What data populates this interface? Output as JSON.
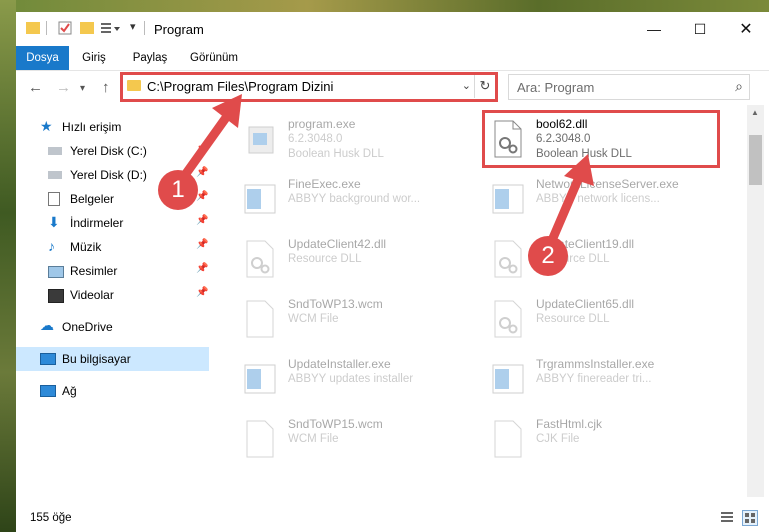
{
  "window": {
    "title": "Program"
  },
  "ribbon": {
    "tabs": [
      "Dosya",
      "Giriş",
      "Paylaş",
      "Görünüm"
    ]
  },
  "address": {
    "path": "C:\\Program Files\\Program Dizini"
  },
  "search": {
    "placeholder": "Ara: Program"
  },
  "nav": {
    "items": [
      {
        "label": "Hızlı erişim",
        "icon": "star-icon",
        "pinned": false
      },
      {
        "label": "Yerel Disk (C:)",
        "icon": "drive-icon",
        "pinned": true
      },
      {
        "label": "Yerel Disk (D:)",
        "icon": "drive-icon",
        "pinned": true
      },
      {
        "label": "Belgeler",
        "icon": "documents-icon",
        "pinned": true
      },
      {
        "label": "İndirmeler",
        "icon": "download-icon",
        "pinned": true
      },
      {
        "label": "Müzik",
        "icon": "music-icon",
        "pinned": true
      },
      {
        "label": "Resimler",
        "icon": "pictures-icon",
        "pinned": true
      },
      {
        "label": "Videolar",
        "icon": "videos-icon",
        "pinned": true
      },
      {
        "label": "OneDrive",
        "icon": "cloud-icon",
        "pinned": false
      },
      {
        "label": "Bu bilgisayar",
        "icon": "computer-icon",
        "pinned": false,
        "selected": true
      },
      {
        "label": "Ağ",
        "icon": "network-icon",
        "pinned": false
      }
    ]
  },
  "files": [
    {
      "name": "program.exe",
      "line1": "6.2.3048.0",
      "line2": "Boolean Husk DLL",
      "faded": true,
      "kind": "exe"
    },
    {
      "name": "bool62.dll",
      "line1": "6.2.3048.0",
      "line2": "Boolean Husk DLL",
      "faded": false,
      "kind": "dll"
    },
    {
      "name": "FineExec.exe",
      "line1": "ABBYY background wor...",
      "line2": "",
      "faded": true,
      "kind": "app"
    },
    {
      "name": "NetworkLicenseServer.exe",
      "line1": "ABBYY network licens...",
      "line2": "",
      "faded": true,
      "kind": "app"
    },
    {
      "name": "UpdateClient42.dll",
      "line1": "Resource DLL",
      "line2": "",
      "faded": true,
      "kind": "dll"
    },
    {
      "name": "UpdateClient19.dll",
      "line1": "Resource DLL",
      "line2": "",
      "faded": true,
      "kind": "dll"
    },
    {
      "name": "SndToWP13.wcm",
      "line1": "WCM File",
      "line2": "",
      "faded": true,
      "kind": "doc"
    },
    {
      "name": "UpdateClient65.dll",
      "line1": "Resource DLL",
      "line2": "",
      "faded": true,
      "kind": "dll"
    },
    {
      "name": "UpdateInstaller.exe",
      "line1": "ABBYY updates installer",
      "line2": "",
      "faded": true,
      "kind": "app"
    },
    {
      "name": "TrgrammsInstaller.exe",
      "line1": "ABBYY finereader tri...",
      "line2": "",
      "faded": true,
      "kind": "app"
    },
    {
      "name": "SndToWP15.wcm",
      "line1": "WCM File",
      "line2": "",
      "faded": true,
      "kind": "doc"
    },
    {
      "name": "FastHtml.cjk",
      "line1": "CJK File",
      "line2": "",
      "faded": true,
      "kind": "doc"
    }
  ],
  "status": {
    "count": "155 öğe"
  },
  "annotations": {
    "badge1": "1",
    "badge2": "2"
  },
  "colors": {
    "accent": "#1979ca",
    "annotation": "#e04b4b",
    "folder": "#f4c84e",
    "selected": "#cce8ff"
  }
}
